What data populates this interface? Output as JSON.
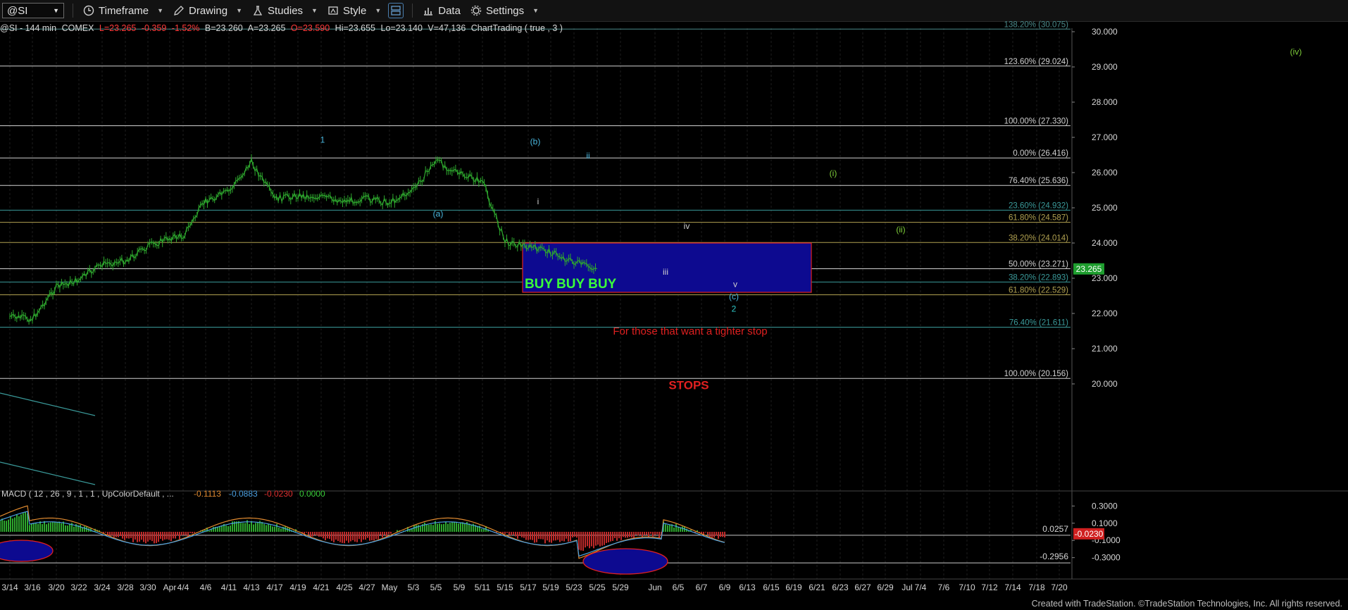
{
  "toolbar": {
    "symbol": "@SI",
    "timeframe": "Timeframe",
    "drawing": "Drawing",
    "studies": "Studies",
    "style": "Style",
    "data": "Data",
    "settings": "Settings"
  },
  "status": {
    "symbol": "@SI - 144 min",
    "exchange": "COMEX",
    "last": "L=23.265",
    "change": "-0.359",
    "change_pct": "-1.52%",
    "bid": "B=23.260",
    "ask": "A=23.265",
    "open": "O=23.590",
    "high": "Hi=23.655",
    "low": "Lo=23.140",
    "volume": "V=47,136",
    "extra": "ChartTrading ( true , 3 )"
  },
  "macd": {
    "label": "MACD ( 12 , 26 , 9 , 1 , 1 , UpColorDefault , ...",
    "v1": "-0.1113",
    "v2": "-0.0883",
    "v3": "-0.0230",
    "v4": "0.0000"
  },
  "footer": "Created with TradeStation. ©TradeStation Technologies, Inc. All rights reserved.",
  "chart_data": {
    "type": "line",
    "title": "@SI - 144 min COMEX",
    "price_axis": {
      "ticks": [
        "30.000",
        "29.000",
        "28.000",
        "27.000",
        "26.000",
        "25.000",
        "24.000",
        "23.000",
        "22.000",
        "21.000",
        "20.000"
      ],
      "range": [
        19.5,
        30.1
      ],
      "current_price": "23.265"
    },
    "x_ticks": [
      "3/14",
      "3/16",
      "3/20",
      "3/22",
      "3/24",
      "3/28",
      "3/30",
      "Apr",
      "4/4",
      "4/6",
      "4/11",
      "4/13",
      "4/17",
      "4/19",
      "4/21",
      "4/25",
      "4/27",
      "May",
      "5/3",
      "5/5",
      "5/9",
      "5/11",
      "5/15",
      "5/17",
      "5/19",
      "5/23",
      "5/25",
      "5/29",
      "Jun",
      "6/5",
      "6/7",
      "6/9",
      "6/13",
      "6/15",
      "6/19",
      "6/21",
      "6/23",
      "6/27",
      "6/29",
      "Jul",
      "7/4",
      "7/6",
      "7/10",
      "7/12",
      "7/14",
      "7/18",
      "7/20"
    ],
    "fib_levels": [
      {
        "label": "138.20% (30.075)",
        "value": 30.075,
        "color": "#4a8a8a"
      },
      {
        "label": "123.60% (29.024)",
        "value": 29.024,
        "color": "#d0d0d0"
      },
      {
        "label": "100.00% (27.330)",
        "value": 27.33,
        "color": "#d0d0d0"
      },
      {
        "label": "0.00% (26.416)",
        "value": 26.416,
        "color": "#d0d0d0"
      },
      {
        "label": "76.40% (25.636)",
        "value": 25.636,
        "color": "#d0d0d0"
      },
      {
        "label": "23.60% (24.932)",
        "value": 24.932,
        "color": "#3a9a9a"
      },
      {
        "label": "61.80% (24.587)",
        "value": 24.587,
        "color": "#b0a050"
      },
      {
        "label": "38.20% (24.014)",
        "value": 24.014,
        "color": "#b0a050"
      },
      {
        "label": "50.00% (23.271)",
        "value": 23.271,
        "color": "#d0d0d0"
      },
      {
        "label": "38.20% (22.893)",
        "value": 22.893,
        "color": "#3a9a9a"
      },
      {
        "label": "61.80% (22.529)",
        "value": 22.529,
        "color": "#b0a050"
      },
      {
        "label": "76.40% (21.611)",
        "value": 21.611,
        "color": "#3a9a9a"
      },
      {
        "label": "100.00% (20.156)",
        "value": 20.156,
        "color": "#d0d0d0"
      }
    ],
    "price_series": [
      [
        "3/14",
        21.9
      ],
      [
        "3/16",
        21.85
      ],
      [
        "3/20",
        22.75
      ],
      [
        "3/22",
        22.95
      ],
      [
        "3/24",
        23.4
      ],
      [
        "3/28",
        23.5
      ],
      [
        "3/30",
        23.9
      ],
      [
        "Apr",
        24.15
      ],
      [
        "4/4",
        24.2
      ],
      [
        "4/6",
        25.2
      ],
      [
        "4/11",
        25.45
      ],
      [
        "4/13",
        26.3
      ],
      [
        "4/17",
        25.25
      ],
      [
        "4/19",
        25.35
      ],
      [
        "4/21",
        25.3
      ],
      [
        "4/25",
        25.2
      ],
      [
        "4/27",
        25.25
      ],
      [
        "May",
        25.15
      ],
      [
        "5/3",
        25.5
      ],
      [
        "5/5",
        26.35
      ],
      [
        "5/9",
        25.95
      ],
      [
        "5/11",
        25.75
      ],
      [
        "5/15",
        24.05
      ],
      [
        "5/17",
        23.9
      ],
      [
        "5/19",
        23.75
      ],
      [
        "5/23",
        23.45
      ],
      [
        "5/25",
        23.265
      ]
    ],
    "wave_labels": [
      {
        "text": "1",
        "x": "4/13",
        "price": 26.85,
        "color": "#4ab8e0"
      },
      {
        "text": "(a)",
        "x": "4/25",
        "price": 24.75,
        "color": "#4ab8e0"
      },
      {
        "text": "(b)",
        "x": "5/5",
        "price": 26.8,
        "color": "#4ab8e0"
      },
      {
        "text": "i",
        "x": "5/5",
        "price": 25.1,
        "color": "#d0d0d0"
      },
      {
        "text": "ii",
        "x": "5/11",
        "price": 26.4,
        "color": "#4ab8e0"
      },
      {
        "text": "iii",
        "x": "5/17",
        "price": 23.1,
        "color": "#d0d0d0"
      },
      {
        "text": "iv",
        "x": "5/19",
        "price": 24.4,
        "color": "#d0d0d0"
      },
      {
        "text": "v",
        "x": "5/25",
        "price": 22.75,
        "color": "#d0d0d0"
      },
      {
        "text": "(c)",
        "x": "5/25",
        "price": 22.4,
        "color": "#4ab8e0"
      },
      {
        "text": "2",
        "x": "5/25",
        "price": 22.05,
        "color": "#2fc8c8"
      },
      {
        "text": "(i)",
        "x": "6/5",
        "price": 25.9,
        "color": "#7fcf3a"
      },
      {
        "text": "(ii)",
        "x": "6/13",
        "price": 24.3,
        "color": "#7fcf3a"
      },
      {
        "text": "(iv)",
        "x": "7/20",
        "price": 29.35,
        "color": "#7fcf3a"
      }
    ],
    "buy_zone": {
      "label": "BUY BUY BUY",
      "from": "5/3",
      "to": "Jun",
      "top": 24.0,
      "bottom": 22.6
    },
    "annotations": [
      {
        "text": "For those that want a tighter stop",
        "x": "5/17",
        "price": 21.5,
        "color": "#e02020"
      },
      {
        "text": "STOPS",
        "x": "5/19",
        "price": 19.95,
        "color": "#e02020"
      }
    ],
    "macd": {
      "label": "MACD ( 12 , 26 , 9 , 1 , 1 , UpColorDefault , ...",
      "axis_ticks": [
        "0.3000",
        "0.1000",
        "-0.1000",
        "-0.3000"
      ],
      "range": [
        -0.45,
        0.45
      ],
      "reference_values": [
        "0.0257",
        "-0.2956"
      ],
      "current": "-0.0230",
      "values": {
        "macd": "-0.1113",
        "signal": "-0.0883",
        "diff": "-0.0230",
        "zero": "0.0000"
      }
    }
  }
}
